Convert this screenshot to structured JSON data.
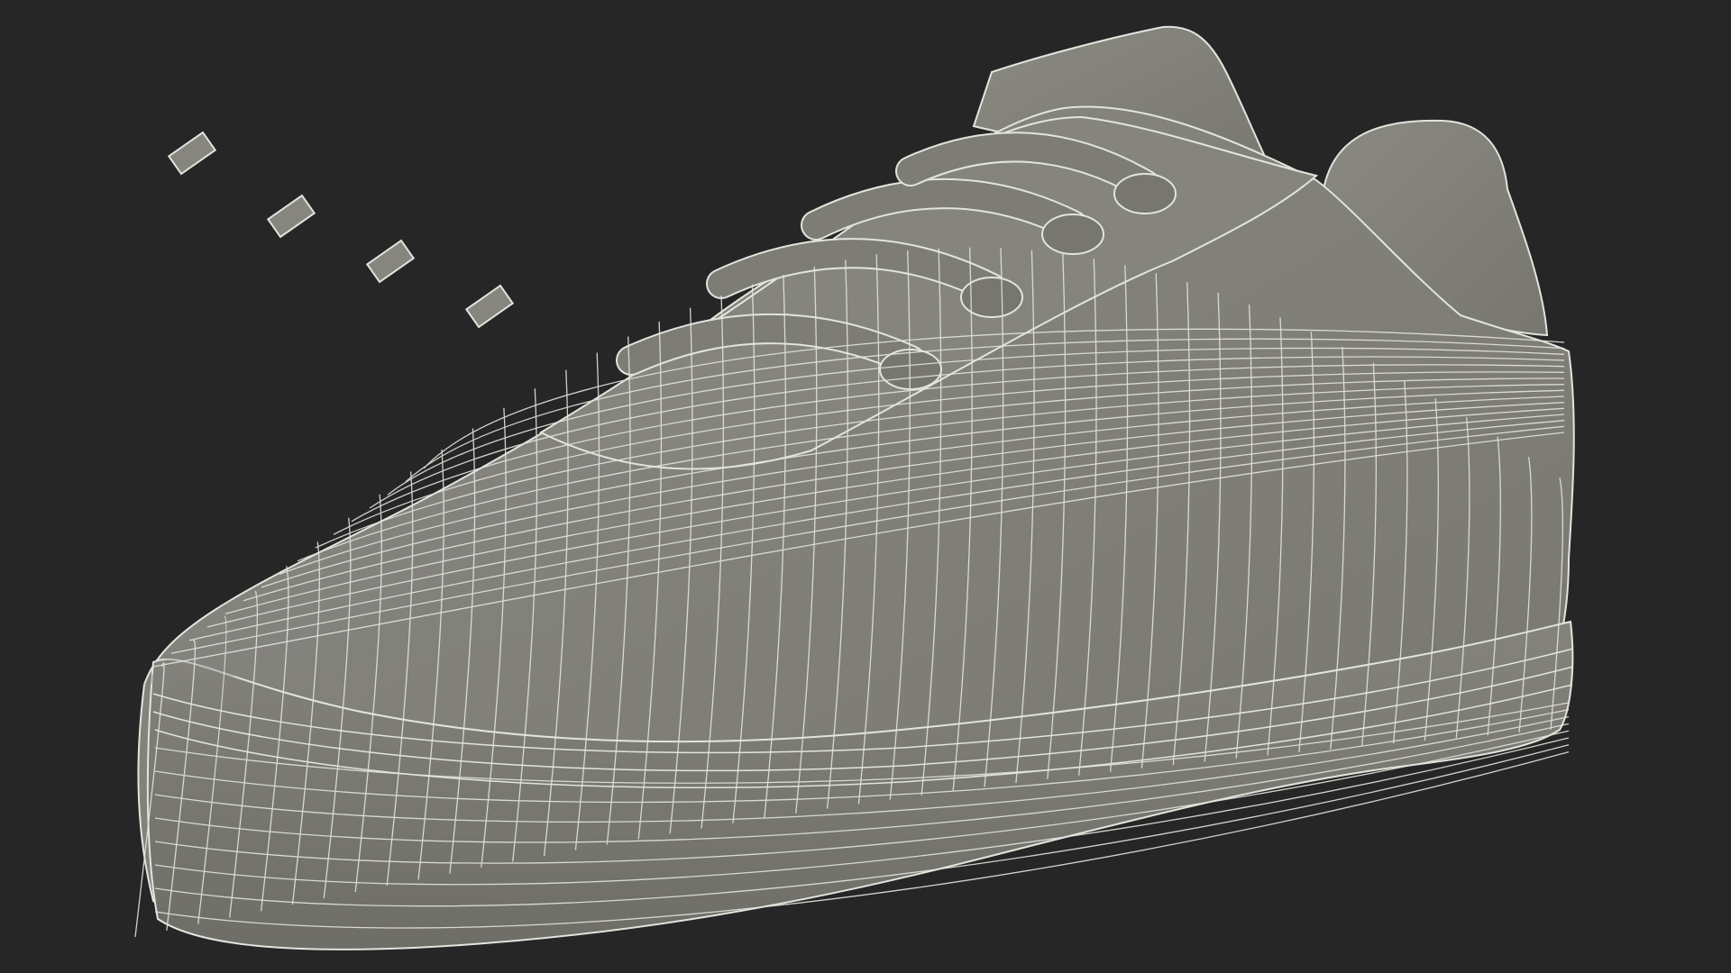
{
  "scene": {
    "subject": "wireframe-sneaker",
    "colors": {
      "background": "#262626",
      "surface": "#7e7d76",
      "surface_light": "#8a8982",
      "surface_dark": "#6c6b65",
      "wire": "#e4e4de"
    }
  }
}
